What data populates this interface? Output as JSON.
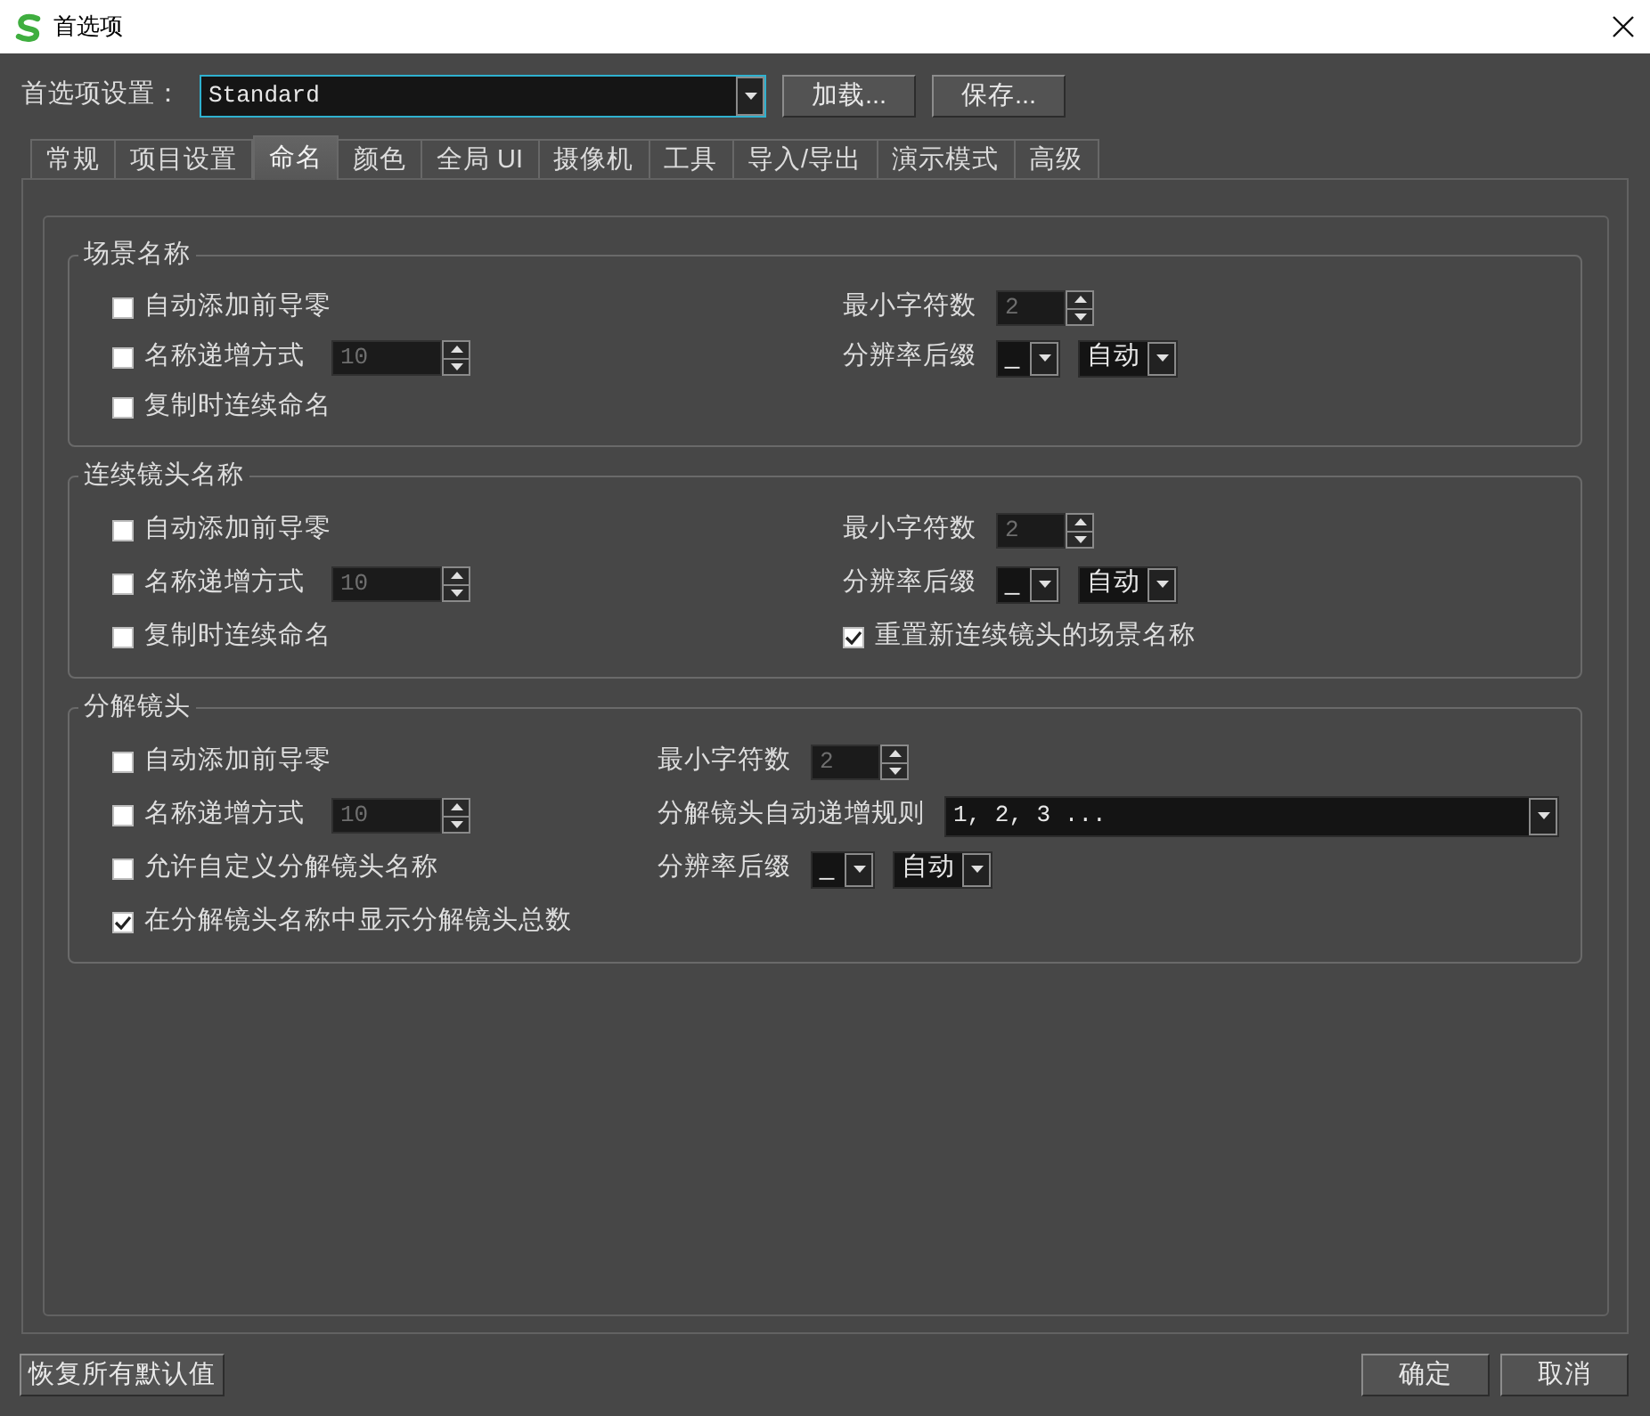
{
  "window": {
    "title": "首选项"
  },
  "preset": {
    "label": "首选项设置：",
    "value": "Standard",
    "buttons": [
      "加载...",
      "保存..."
    ]
  },
  "tabs": [
    {
      "label": "常规",
      "selected": false
    },
    {
      "label": "项目设置",
      "selected": false
    },
    {
      "label": "命名",
      "selected": true
    },
    {
      "label": "颜色",
      "selected": false
    },
    {
      "label": "全局 UI",
      "selected": false
    },
    {
      "label": "摄像机",
      "selected": false
    },
    {
      "label": "工具",
      "selected": false
    },
    {
      "label": "导入/导出",
      "selected": false
    },
    {
      "label": "演示模式",
      "selected": false
    },
    {
      "label": "高级",
      "selected": false
    }
  ],
  "groups": [
    {
      "title": "场景名称",
      "left": [
        {
          "kind": "checkbox",
          "label": "自动添加前导零",
          "checked": false
        },
        {
          "kind": "checkbox",
          "label": "名称递增方式",
          "checked": false,
          "spin": {
            "value": "10",
            "disabled": true
          }
        },
        {
          "kind": "checkbox",
          "label": "复制时连续命名",
          "checked": false
        }
      ],
      "right": [
        {
          "kind": "spin",
          "label": "最小字符数",
          "value": "2",
          "disabled": true
        },
        {
          "kind": "dropdowns",
          "label": "分辨率后缀",
          "values": [
            "_",
            "自动"
          ]
        }
      ]
    },
    {
      "title": "连续镜头名称",
      "left": [
        {
          "kind": "checkbox",
          "label": "自动添加前导零",
          "checked": false
        },
        {
          "kind": "checkbox",
          "label": "名称递增方式",
          "checked": false,
          "spin": {
            "value": "10",
            "disabled": true
          }
        },
        {
          "kind": "checkbox",
          "label": "复制时连续命名",
          "checked": false
        }
      ],
      "right": [
        {
          "kind": "spin",
          "label": "最小字符数",
          "value": "2",
          "disabled": true
        },
        {
          "kind": "dropdowns",
          "label": "分辨率后缀",
          "values": [
            "_",
            "自动"
          ]
        },
        {
          "kind": "checkbox",
          "label": "重置新连续镜头的场景名称",
          "checked": true
        }
      ]
    },
    {
      "title": "分解镜头",
      "left": [
        {
          "kind": "checkbox",
          "label": "自动添加前导零",
          "checked": false
        },
        {
          "kind": "checkbox",
          "label": "名称递增方式",
          "checked": false,
          "spin": {
            "value": "10",
            "disabled": true
          }
        },
        {
          "kind": "checkbox",
          "label": "允许自定义分解镜头名称",
          "checked": false
        },
        {
          "kind": "checkbox",
          "label": "在分解镜头名称中显示分解镜头总数",
          "checked": true
        }
      ],
      "right": [
        {
          "kind": "spin",
          "label": "最小字符数",
          "value": "2",
          "disabled": true
        },
        {
          "kind": "combo",
          "label": "分解镜头自动递增规则",
          "value": "1, 2, 3 ..."
        },
        {
          "kind": "dropdowns",
          "label": "分辨率后缀",
          "values": [
            "_",
            "自动"
          ]
        }
      ]
    }
  ],
  "footer": {
    "reset_button": "恢复所有默认值",
    "buttons": [
      "确定",
      "取消"
    ]
  }
}
